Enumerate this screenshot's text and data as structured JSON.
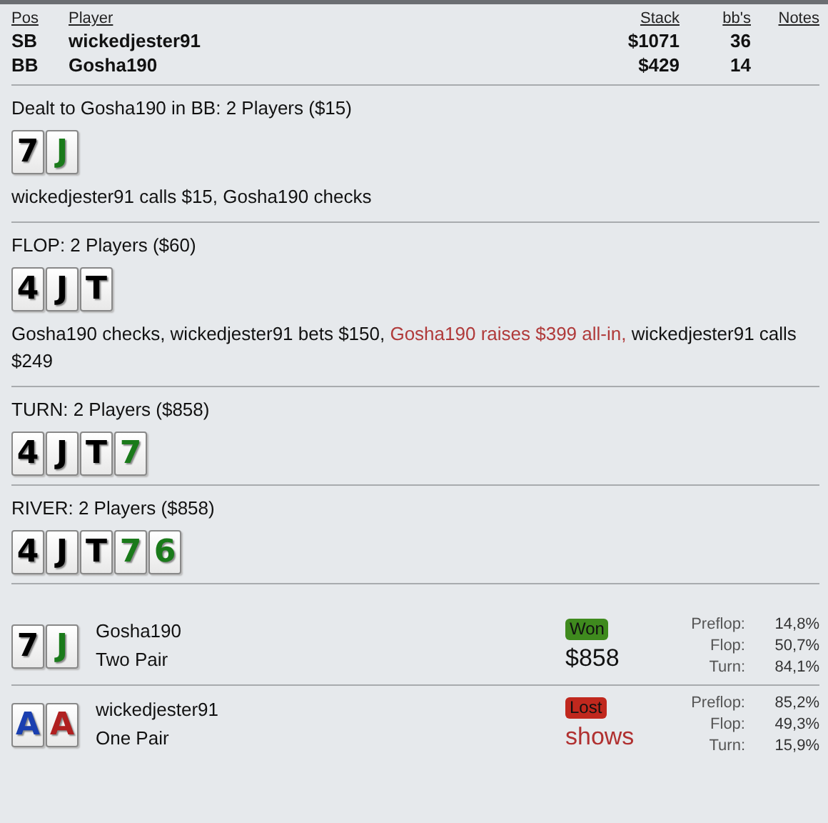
{
  "players": {
    "columns": [
      "Pos",
      "Player",
      "Stack",
      "bb's",
      "Notes"
    ],
    "rows": [
      {
        "pos": "SB",
        "player": "wickedjester91",
        "stack": "$1071",
        "bbs": "36"
      },
      {
        "pos": "BB",
        "player": "Gosha190",
        "stack": "$429",
        "bbs": "14"
      }
    ]
  },
  "streets": [
    {
      "title": "Dealt to Gosha190 in BB: 2 Players ($15)",
      "cards": [
        {
          "rank": "7",
          "color": "#000000"
        },
        {
          "rank": "J",
          "color": "#1a7a1a"
        }
      ],
      "actions": [
        {
          "text": "wickedjester91 calls $15, Gosha190 checks",
          "highlight": false
        }
      ]
    },
    {
      "title": "FLOP: 2 Players ($60)",
      "cards": [
        {
          "rank": "4",
          "color": "#000000"
        },
        {
          "rank": "J",
          "color": "#000000"
        },
        {
          "rank": "T",
          "color": "#000000"
        }
      ],
      "actions": [
        {
          "text": "Gosha190 checks, wickedjester91 bets $150, ",
          "highlight": false
        },
        {
          "text": "Gosha190 raises $399 all-in,",
          "highlight": true
        },
        {
          "text": " wickedjester91 calls $249",
          "highlight": false
        }
      ]
    },
    {
      "title": "TURN: 2 Players ($858)",
      "cards": [
        {
          "rank": "4",
          "color": "#000000"
        },
        {
          "rank": "J",
          "color": "#000000"
        },
        {
          "rank": "T",
          "color": "#000000"
        },
        {
          "rank": "7",
          "color": "#1a7a1a"
        }
      ]
    },
    {
      "title": "RIVER: 2 Players ($858)",
      "cards": [
        {
          "rank": "4",
          "color": "#000000"
        },
        {
          "rank": "J",
          "color": "#000000"
        },
        {
          "rank": "T",
          "color": "#000000"
        },
        {
          "rank": "7",
          "color": "#1a7a1a"
        },
        {
          "rank": "6",
          "color": "#1a7a1a"
        }
      ]
    }
  ],
  "showdown": [
    {
      "cards": [
        {
          "rank": "7",
          "color": "#000000"
        },
        {
          "rank": "J",
          "color": "#1a7a1a"
        }
      ],
      "player": "Gosha190",
      "hand": "Two Pair",
      "kind": "won",
      "badge": "Won",
      "amount": "$858",
      "equity": [
        {
          "label": "Preflop:",
          "value": "14,8%"
        },
        {
          "label": "Flop:",
          "value": "50,7%"
        },
        {
          "label": "Turn:",
          "value": "84,1%"
        }
      ]
    },
    {
      "cards": [
        {
          "rank": "A",
          "color": "#1a3fb0"
        },
        {
          "rank": "A",
          "color": "#b02020"
        }
      ],
      "player": "wickedjester91",
      "hand": "One Pair",
      "kind": "lost",
      "badge": "Lost",
      "amount": "shows",
      "equity": [
        {
          "label": "Preflop:",
          "value": "85,2%"
        },
        {
          "label": "Flop:",
          "value": "49,3%"
        },
        {
          "label": "Turn:",
          "value": "15,9%"
        }
      ]
    }
  ]
}
